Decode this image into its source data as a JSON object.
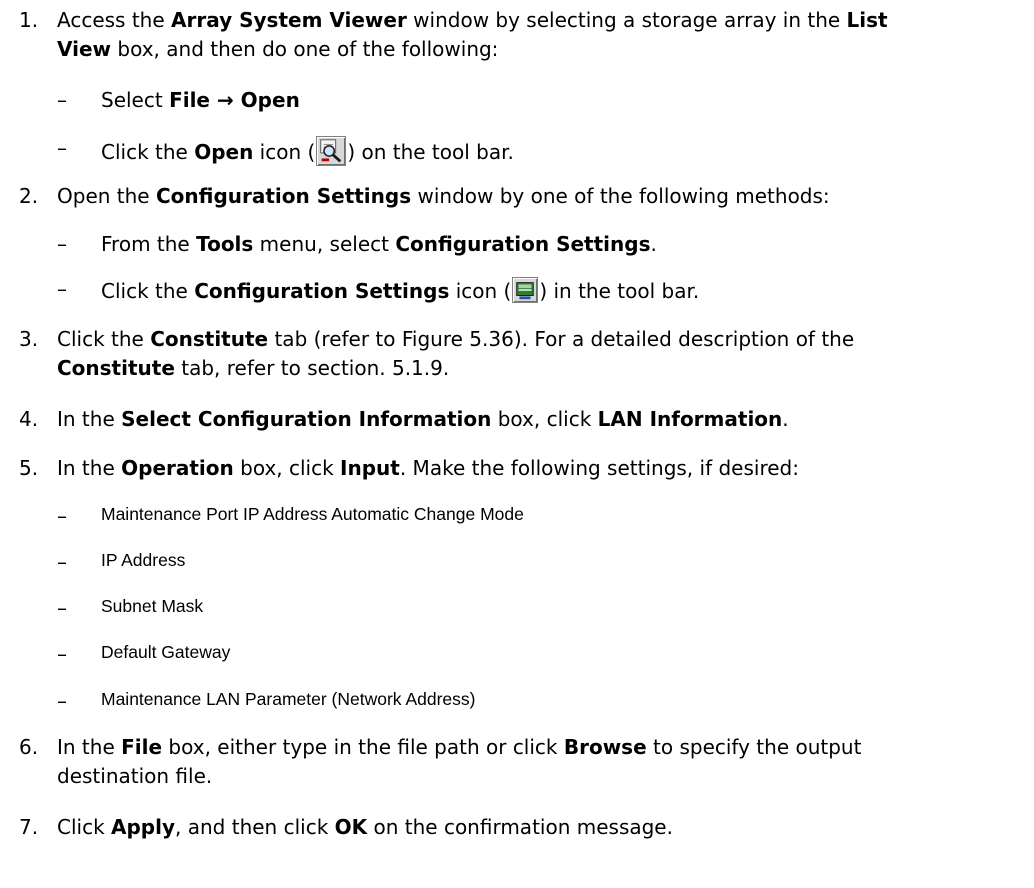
{
  "steps": [
    {
      "num": "1.",
      "line1": [
        "Access the ",
        "Array System Viewer",
        " window by selecting a storage array in the ",
        "List"
      ],
      "line2": [
        "View",
        " box, and then do one of the following:"
      ]
    },
    {
      "num": "2.",
      "line1": [
        "Open the ",
        "Configuration Settings",
        " window by one of the following methods:"
      ]
    },
    {
      "num": "3.",
      "line1": [
        "Click the ",
        "Constitute",
        " tab (refer to Figure 5.36). For a detailed description of the"
      ],
      "line2": [
        "Constitute",
        " tab, refer to section. 5.1.9."
      ]
    },
    {
      "num": "4.",
      "line1": [
        "In the ",
        "Select Configuration Information",
        " box, click ",
        "LAN Information",
        "."
      ]
    },
    {
      "num": "5.",
      "line1": [
        "In the ",
        "Operation",
        " box, click ",
        "Input",
        ". Make the following settings, if desired:"
      ]
    },
    {
      "num": "6.",
      "line1": [
        "In the ",
        "File",
        " box, either type in the file path or click ",
        "Browse",
        " to specify the output"
      ],
      "line2": [
        "destination file."
      ]
    },
    {
      "num": "7.",
      "line1": [
        "Click ",
        "Apply",
        ", and then click ",
        "OK",
        " on the confirmation message."
      ]
    }
  ],
  "subs": {
    "s1a": [
      "Select ",
      "File → Open"
    ],
    "s1b": [
      "Click the ",
      "Open",
      " icon (",
      ") on the tool bar."
    ],
    "s2a": [
      "From the ",
      "Tools",
      " menu, select ",
      "Configuration Settings",
      "."
    ],
    "s2b": [
      "Click the ",
      "Configuration Settings",
      " icon (",
      ") in the tool bar."
    ],
    "s5": [
      "Maintenance Port IP Address Automatic Change Mode",
      "IP Address",
      "Subnet Mask",
      "Default Gateway",
      "Maintenance LAN Parameter (Network Address)"
    ]
  },
  "dash": "–",
  "icons": {
    "open": "open-magnifier-icon",
    "config": "configuration-settings-icon"
  }
}
